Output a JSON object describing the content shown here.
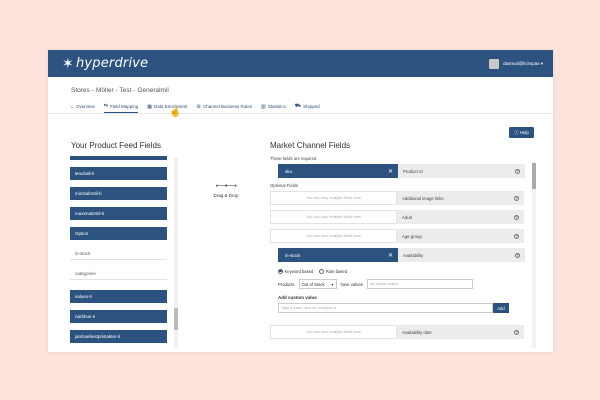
{
  "brand": {
    "name": "hyperdrive",
    "logo_icon": "star-icon"
  },
  "user": {
    "email": "dasmuli@lichspas"
  },
  "breadcrumb": [
    "Stores",
    "-",
    "Möller - Test",
    "-",
    "Generalmil"
  ],
  "tabs": [
    {
      "label": "Overview",
      "icon": "home-icon",
      "active": false
    },
    {
      "label": "Field Mapping",
      "icon": "mapping-icon",
      "active": true
    },
    {
      "label": "Data Enrichment",
      "icon": "table-icon",
      "active": false
    },
    {
      "label": "Channel Business Rules",
      "icon": "rules-icon",
      "active": false
    },
    {
      "label": "Statistics",
      "icon": "chart-icon",
      "active": false
    },
    {
      "label": "Shipped",
      "icon": "truck-icon",
      "active": false
    }
  ],
  "help_label": "Help",
  "left_title": "Your Product Feed Fields",
  "right_title": "Market Channel Fields",
  "left_items": [
    {
      "label": "",
      "style": "blue"
    },
    {
      "label": "lenuhall-ti",
      "style": "blue"
    },
    {
      "label": "minstabrstil-ti",
      "style": "blue"
    },
    {
      "label": "maxirnabrstil-ti",
      "style": "blue"
    },
    {
      "label": "Option",
      "style": "blue"
    },
    {
      "label": "in-stock",
      "style": "plain"
    },
    {
      "label": "categories",
      "style": "plain"
    },
    {
      "label": "values-ti",
      "style": "blue"
    },
    {
      "label": "narbhus-ti",
      "style": "blue"
    },
    {
      "label": "jambsebestpristakter-ti",
      "style": "blue"
    }
  ],
  "drag_drop": {
    "arrows": "⟵•⟶",
    "label": "Drag & Drop"
  },
  "required_label": "These fields are required",
  "optional_label": "Optional Fields",
  "drop_placeholder": "You can drop multiple fields here",
  "required_fields": [
    {
      "source": "sku",
      "target": "Product Id"
    }
  ],
  "optional_fields_before": [
    {
      "source": "",
      "target": "Additional image links"
    },
    {
      "source": "",
      "target": "Adult"
    },
    {
      "source": "",
      "target": "Age group"
    },
    {
      "source": "in-stock",
      "target": "Availability"
    }
  ],
  "config": {
    "radio_keyword": "Keyword based",
    "radio_rule": "Rule based",
    "products_label": "Products",
    "products_select": "Out of Stock",
    "have_values_label": "have values",
    "have_values_placeholder": "No results match",
    "add_custom_label": "Add custom value",
    "custom_placeholder": "Type a value here for example /a",
    "add_button": "Add"
  },
  "optional_fields_after": [
    {
      "source": "",
      "target": "Availability date"
    }
  ],
  "colors": {
    "brand_blue": "#2c5280",
    "background": "#fce4dc"
  }
}
